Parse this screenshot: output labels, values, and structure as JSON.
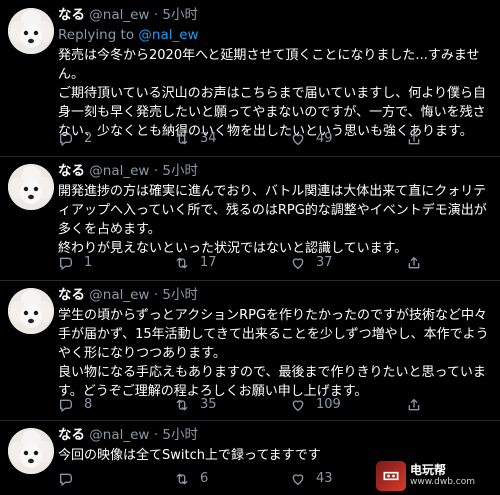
{
  "tweets": [
    {
      "name": "なる",
      "handle": "@nal_ew",
      "dot": "·",
      "time": "5小时",
      "replying_prefix": "Replying to",
      "replying_handle": "@nal_ew",
      "text": "発売は今冬から2020年へと延期させて頂くことになりました...すみません。\nご期待頂いている沢山のお声はこちらまで届いていますし、何より僕ら自身一刻も早く発売したいと願ってやまないのですが、一方で、悔いを残さない、少なくとも納得のいく物を出したいという思いも強くあります。",
      "replies": "2",
      "retweets": "34",
      "likes": "49"
    },
    {
      "name": "なる",
      "handle": "@nal_ew",
      "dot": "·",
      "time": "5小时",
      "text": "開発進捗の方は確実に進んでおり、バトル関連は大体出来て直にクォリティアップへ入っていく所で、残るのはRPG的な調整やイベントデモ演出が多くを占めます。\n終わりが見えないといった状況ではないと認識しています。",
      "replies": "1",
      "retweets": "17",
      "likes": "37"
    },
    {
      "name": "なる",
      "handle": "@nal_ew",
      "dot": "·",
      "time": "5小时",
      "text": "学生の頃からずっとアクションRPGを作りたかったのですが技術など中々手が届かず、15年活動してきて出来ることを少しずつ増やし、本作でようやく形になりつつあります。\n良い物になる手応えもありますので、最後まで作りきりたいと思っています。どうぞご理解の程よろしくお願い申し上げます。",
      "replies": "8",
      "retweets": "35",
      "likes": "109"
    },
    {
      "name": "なる",
      "handle": "@nal_ew",
      "dot": "·",
      "time": "5小时",
      "text": "今回の映像は全てSwitch上で録ってますです",
      "replies": "",
      "retweets": "6",
      "likes": "43"
    }
  ],
  "icons": {
    "reply": "reply-icon",
    "retweet": "retweet-icon",
    "like": "heart-icon",
    "share": "share-icon"
  },
  "watermark": {
    "cn": "电玩帮",
    "en": "www.dwb.com"
  },
  "colors": {
    "background": "#000000",
    "secondary_text": "#8b98a5",
    "link": "#1d9bf0"
  }
}
